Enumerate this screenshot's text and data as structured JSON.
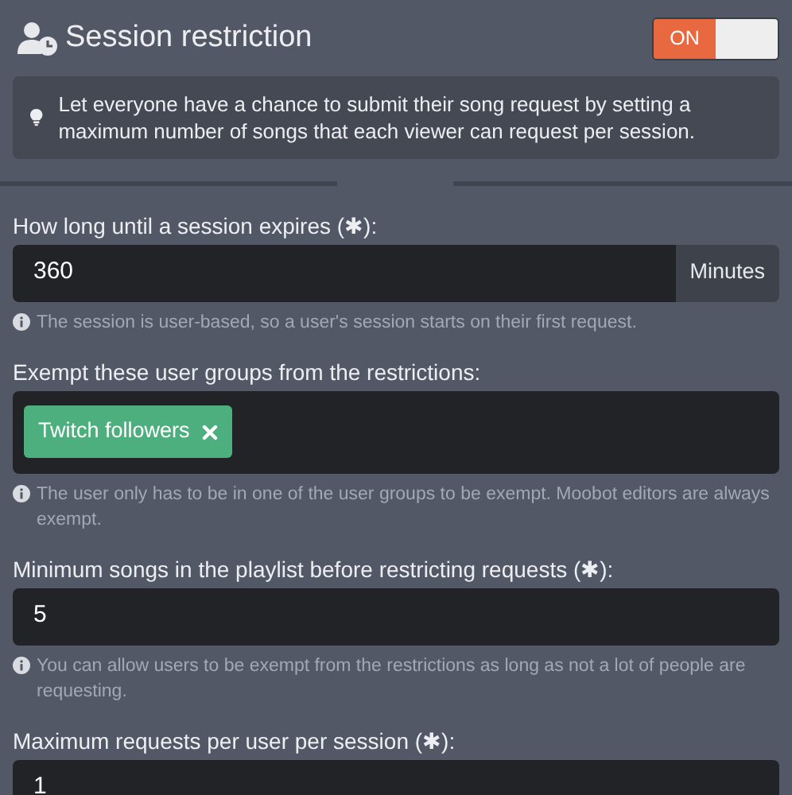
{
  "header": {
    "title": "Session restriction",
    "toggle": {
      "label": "ON",
      "on": true
    }
  },
  "info": "Let everyone have a chance to submit their song request by setting a maximum number of songs that each viewer can request per session.",
  "fields": [
    {
      "kind": "input",
      "label": "How long until a session expires (✱):",
      "value": "360",
      "suffix": "Minutes",
      "help": "The session is user-based, so a user's session starts on their first request."
    },
    {
      "kind": "tags",
      "label": "Exempt these user groups from the restrictions:",
      "tags": [
        "Twitch followers"
      ],
      "help": "The user only has to be in one of the user groups to be exempt. Moobot editors are always exempt."
    },
    {
      "kind": "input",
      "label": "Minimum songs in the playlist before restricting requests (✱):",
      "value": "5",
      "help": "You can allow users to be exempt from the restrictions as long as not a lot of people are requesting."
    },
    {
      "kind": "input",
      "label": "Maximum requests per user per session (✱):",
      "value": "1"
    }
  ]
}
